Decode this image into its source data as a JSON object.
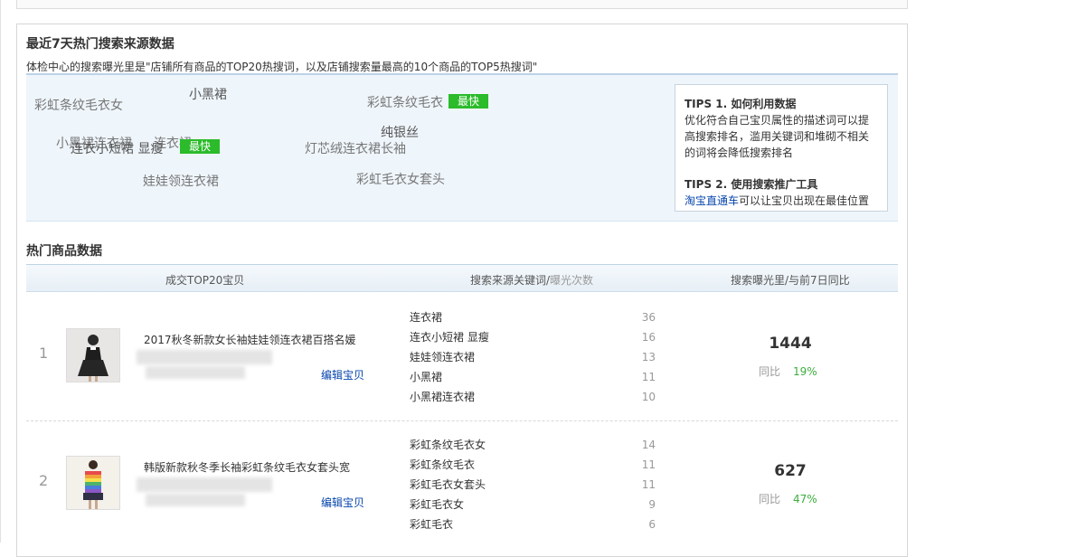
{
  "heat": {
    "title": "最近7天热门搜索来源数据",
    "desc": "体检中心的搜索曝光里是\"店铺所有商品的TOP20热搜词，以及店铺搜索量最高的10个商品的TOP5热搜词\"",
    "keywords": {
      "k1": "彩虹条纹毛衣女",
      "k2": "小黑裙",
      "k3": "彩虹条纹毛衣",
      "k4": "纯银丝",
      "k5": "小黑裙连衣裙",
      "k6": "连衣小短裙 显瘦",
      "k7": "连衣裙",
      "k8": "灯芯绒连衣裙长袖",
      "k9": "娃娃领连衣裙",
      "k10": "彩虹毛衣女套头"
    },
    "fast_label": "最快",
    "tips": {
      "t1_title": "TIPS 1. 如何利用数据",
      "t1_l1": "优化符合自己宝贝属性的描述词可以提",
      "t1_l2": "高搜索排名，滥用关键词和堆砌不相关",
      "t1_l3": "的词将会降低搜索排名",
      "t2_title": "TIPS 2. 使用搜索推广工具",
      "t2_link": "淘宝直通车",
      "t2_rest": "可以让宝贝出现在最佳位置"
    }
  },
  "hot": {
    "title": "热门商品数据",
    "col1": "成交TOP20宝贝",
    "col2a": "搜索来源关键词/",
    "col2b": "曝光次数",
    "col3": "搜索曝光里/与前7日同比",
    "edit_label": "编辑宝贝",
    "yoy_label": "同比",
    "rows": [
      {
        "rank": "1",
        "name": "2017秋冬新款女长袖娃娃领连衣裙百搭名媛",
        "keywords": [
          {
            "k": "连衣裙",
            "c": "36"
          },
          {
            "k": "连衣小短裙 显瘦",
            "c": "16"
          },
          {
            "k": "娃娃领连衣裙",
            "c": "13"
          },
          {
            "k": "小黑裙",
            "c": "11"
          },
          {
            "k": "小黑裙连衣裙",
            "c": "10"
          }
        ],
        "exposure": "1444",
        "yoy": "19%"
      },
      {
        "rank": "2",
        "name": "韩版新款秋冬季长袖彩虹条纹毛衣女套头宽",
        "keywords": [
          {
            "k": "彩虹条纹毛衣女",
            "c": "14"
          },
          {
            "k": "彩虹条纹毛衣",
            "c": "11"
          },
          {
            "k": "彩虹毛衣女套头",
            "c": "11"
          },
          {
            "k": "彩虹毛衣女",
            "c": "9"
          },
          {
            "k": "彩虹毛衣",
            "c": "6"
          }
        ],
        "exposure": "627",
        "yoy": "47%"
      }
    ]
  },
  "colors": {
    "accent_green": "#2bbb2b",
    "link_blue": "#0645ad",
    "percent_green": "#3cae3c"
  }
}
